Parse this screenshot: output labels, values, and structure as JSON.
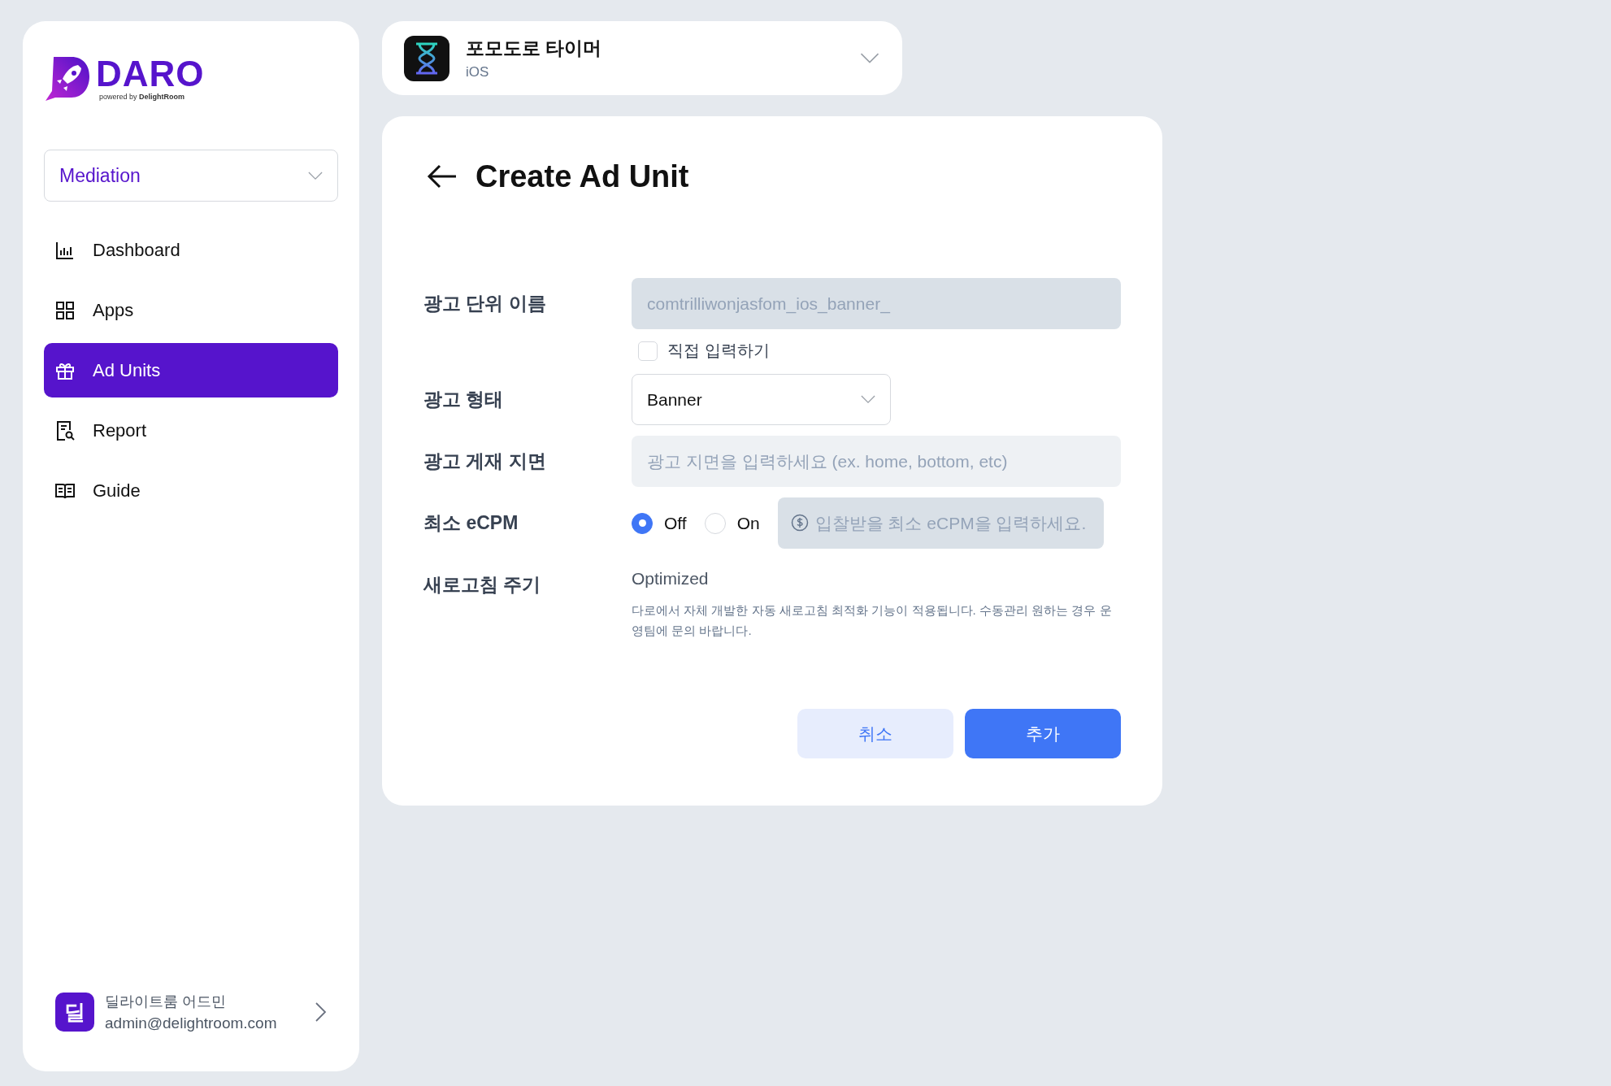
{
  "sidebar": {
    "logo": {
      "name": "DARO",
      "tagline": "powered by **DelightRoom**"
    },
    "product_select": {
      "value": "Mediation"
    },
    "items": [
      {
        "label": "Dashboard",
        "kind": "chart",
        "selected": false
      },
      {
        "label": "Apps",
        "kind": "grid",
        "selected": false
      },
      {
        "label": "Ad Units",
        "kind": "gift",
        "selected": true
      },
      {
        "label": "Report",
        "kind": "report",
        "selected": false
      },
      {
        "label": "Guide",
        "kind": "book",
        "selected": false
      }
    ],
    "user": {
      "avatar": "딜",
      "name": "딜라이트룸 어드민",
      "email": "admin@delightroom.com"
    }
  },
  "app_select": {
    "name": "포모도로 타이머",
    "platform": "iOS"
  },
  "page": {
    "title": "Create Ad Unit",
    "name_field": {
      "label": "광고 단위 이름",
      "value": "comtrilliwonjasfom_ios_banner_",
      "disabled": true
    },
    "manual_input": {
      "label": "직접 입력하기",
      "checked": false
    },
    "type_field": {
      "label": "광고 형태",
      "value": "Banner"
    },
    "placement_field": {
      "label": "광고 게재 지면",
      "placeholder": "광고 지면을 입력하세요 (ex. home, bottom, etc)"
    },
    "ecpm": {
      "label": "최소 eCPM",
      "options": [
        {
          "label": "Off",
          "selected": true
        },
        {
          "label": "On",
          "selected": false
        }
      ],
      "placeholder": "입찰받을 최소 eCPM을 입력하세요.",
      "disabled": true
    },
    "refresh": {
      "label": "새로고침 주기",
      "value": "Optimized",
      "description": "다로에서 자체 개발한 자동 새로고침 최적화 기능이 적용됩니다. 수동관리 원하는 경우 운영팀에 문의 바랍니다."
    },
    "buttons": [
      {
        "label": "취소",
        "kind": "secondary"
      },
      {
        "label": "추가",
        "kind": "primary"
      }
    ]
  }
}
